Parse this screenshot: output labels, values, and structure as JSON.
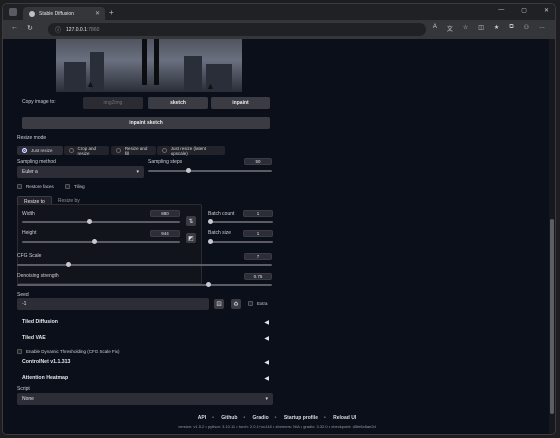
{
  "browser": {
    "tab_title": "Stable Diffusion",
    "url_host": "127.0.0.1",
    "url_port": ":7860",
    "window_buttons": [
      "—",
      "▢",
      "✕"
    ]
  },
  "copy_image": {
    "label": "Copy image to:",
    "buttons": [
      "img2img",
      "sketch",
      "inpaint"
    ],
    "inpaint_sketch": "inpaint sketch"
  },
  "resize_mode": {
    "label": "Resize mode",
    "options": [
      "Just resize",
      "Crop and resize",
      "Resize and fill",
      "Just resize (latent upscale)"
    ],
    "selected": "Just resize"
  },
  "sampling": {
    "method_label": "Sampling method",
    "method_value": "Euler a",
    "steps_label": "Sampling steps",
    "steps_value": "50",
    "steps_fraction": 0.33
  },
  "checks": {
    "restore_faces": "Restore faces",
    "tiling": "Tiling"
  },
  "size_tabs": [
    "Resize to",
    "Resize by"
  ],
  "dimensions": {
    "width_label": "Width",
    "width_value": "880",
    "width_fraction": 0.43,
    "height_label": "Height",
    "height_value": "944",
    "height_fraction": 0.46,
    "swap_icon": "swap-icon",
    "ratio_icon": "ratio-icon"
  },
  "batch": {
    "count_label": "Batch count",
    "count_value": "1",
    "size_label": "Batch size",
    "size_value": "1"
  },
  "cfg": {
    "label": "CFG Scale",
    "value": "7",
    "fraction": 0.2
  },
  "denoise": {
    "label": "Denoising strength",
    "value": "0.75",
    "fraction": 0.75
  },
  "seed": {
    "label": "Seed",
    "value": "-1",
    "extra_label": "Extra"
  },
  "accordions": {
    "tiled_diffusion": "Tiled Diffusion",
    "tiled_vae": "Tiled VAE",
    "dynamic_threshold": "Enable Dynamic Thresholding (CFG Scale Fix)",
    "controlnet": "ControlNet v1.1.313",
    "attention_heatmap": "Attention Heatmap"
  },
  "script": {
    "label": "Script",
    "value": "None"
  },
  "footer": {
    "links": [
      "API",
      "Github",
      "Gradio",
      "Startup profile",
      "Reload UI"
    ],
    "version_line": "version: v1.5.2  •  python: 3.10.11  •  torch: 2.0.1+cu118  •  xformers: N/A  •  gradio: 3.32.0  •  checkpoint: d5fe6c8ae2d"
  },
  "colors": {
    "page_bg": "#0b0f19",
    "panel_bg": "#1f2028",
    "button_bg": "#3a3b43"
  }
}
